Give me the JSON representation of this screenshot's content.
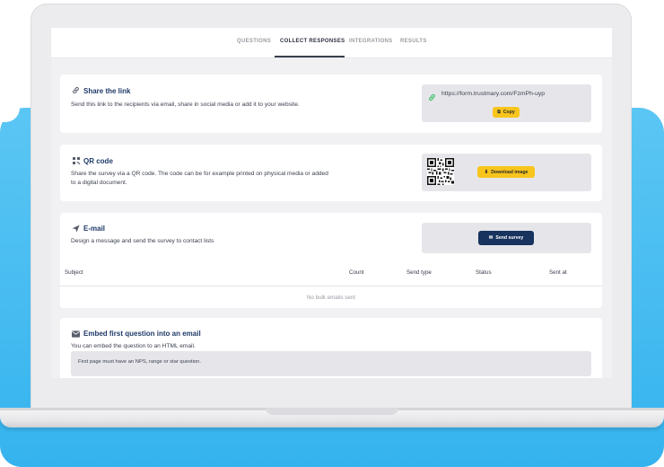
{
  "tabs": [
    {
      "label": "QUESTIONS",
      "active": false
    },
    {
      "label": "COLLECT RESPONSES",
      "active": true
    },
    {
      "label": "INTEGRATIONS",
      "active": false
    },
    {
      "label": "RESULTS",
      "active": false
    }
  ],
  "share_link": {
    "title": "Share the link",
    "description": "Send this link to the recipients via email, share in social media or add it to your website.",
    "url": "https://form.trustmary.com/FzmPh-uyp",
    "copy_label": "Copy",
    "icon": "link-icon"
  },
  "qr_code": {
    "title": "QR code",
    "description": "Share the survey via a QR code. The code can be for example printed on physical media or added to a digital document.",
    "download_label": "Download image",
    "icon": "qr-icon"
  },
  "email": {
    "title": "E-mail",
    "description": "Design a message and send the survey to contact lists",
    "send_label": "Send survey",
    "icon": "send-icon",
    "table_headers": [
      "Subject",
      "Count",
      "Send type",
      "Status",
      "Sent at"
    ],
    "empty_text": "No bulk emails sent"
  },
  "embed": {
    "title": "Embed first question into an email",
    "description": "You can embed the question to an HTML email.",
    "notice": "First page must have an NPS, range or star question.",
    "icon": "mail-icon"
  },
  "colors": {
    "accent_yellow": "#f8c51c",
    "navy": "#17335e",
    "title_blue": "#1f3a68",
    "link_green": "#3fbf6a",
    "backdrop_blue": "#35b3ee"
  }
}
